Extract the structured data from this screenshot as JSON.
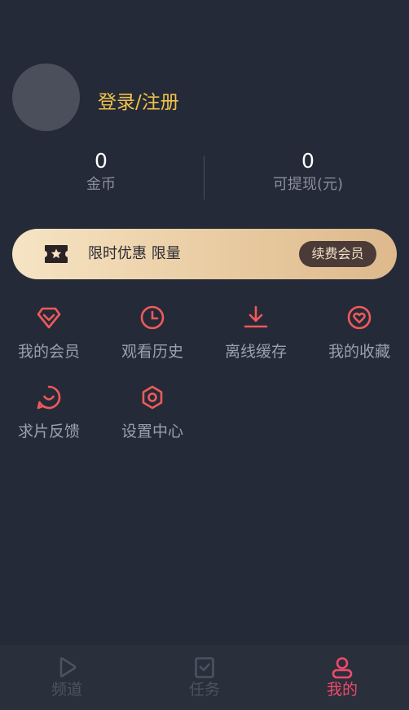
{
  "profile": {
    "login_label": "登录/注册"
  },
  "stats": {
    "coins": {
      "value": "0",
      "label": "金币"
    },
    "cash": {
      "value": "0",
      "label": "可提现(元)"
    }
  },
  "banner": {
    "promo_text": "限时优惠 限量",
    "renew_label": "续费会员"
  },
  "menu": [
    {
      "label": "我的会员",
      "icon": "gem-icon"
    },
    {
      "label": "观看历史",
      "icon": "clock-icon"
    },
    {
      "label": "离线缓存",
      "icon": "download-icon"
    },
    {
      "label": "我的收藏",
      "icon": "heart-icon"
    },
    {
      "label": "求片反馈",
      "icon": "feedback-icon"
    },
    {
      "label": "设置中心",
      "icon": "settings-icon"
    }
  ],
  "nav": [
    {
      "label": "频道",
      "icon": "play-icon"
    },
    {
      "label": "任务",
      "icon": "task-icon"
    },
    {
      "label": "我的",
      "icon": "user-icon"
    }
  ],
  "colors": {
    "background": "#252a38",
    "accent": "#f04a69",
    "login": "#f1c24a",
    "banner_gold": "#e9cba1"
  }
}
